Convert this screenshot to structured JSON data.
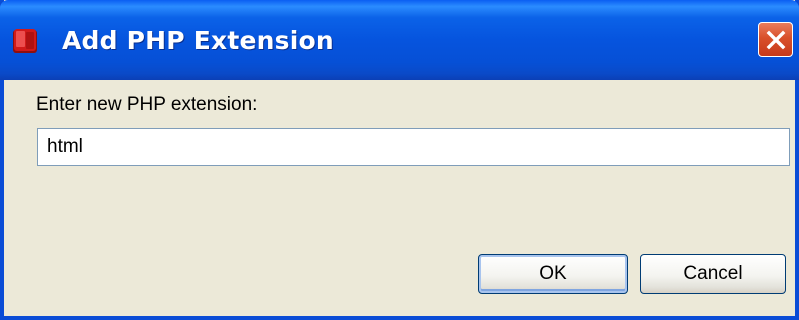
{
  "window": {
    "title": "Add PHP Extension",
    "icon": "app-cube-icon",
    "close_icon": "close-icon",
    "titlebar_color": "#0654de",
    "close_color": "#d9502a",
    "background_color": "#ece9d8"
  },
  "form": {
    "prompt": "Enter new PHP extension:",
    "extension_value": "html",
    "input_border_color": "#7f9db9"
  },
  "buttons": {
    "ok_label": "OK",
    "cancel_label": "Cancel"
  }
}
